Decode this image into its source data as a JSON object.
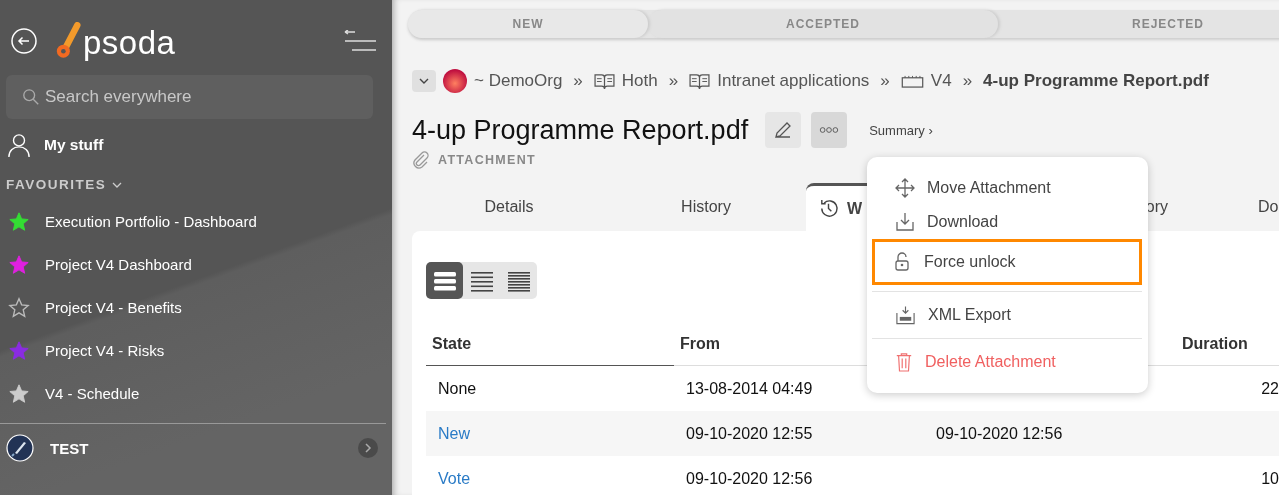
{
  "sidebar": {
    "logo": "psoda",
    "search": {
      "placeholder": "Search everywhere"
    },
    "my_stuff": "My stuff",
    "favourites_heading": "FAVOURITES",
    "favourites": [
      {
        "label": "Execution Portfolio - Dashboard",
        "kind": "filled",
        "color": "#33dd33"
      },
      {
        "label": "Project V4 Dashboard",
        "kind": "filled",
        "color": "#e020e0"
      },
      {
        "label": "Project V4 - Benefits",
        "kind": "outline",
        "color": "#bbbbbb"
      },
      {
        "label": "Project V4 - Risks",
        "kind": "filled",
        "color": "#8a2be2"
      },
      {
        "label": "V4 - Schedule",
        "kind": "filled",
        "color": "#cccccc"
      }
    ],
    "workspace": "TEST"
  },
  "steps": [
    {
      "label": "NEW"
    },
    {
      "label": "ACCEPTED"
    },
    {
      "label": "REJECTED"
    }
  ],
  "breadcrumb": [
    {
      "label": "~ DemoOrg",
      "kind": "org"
    },
    {
      "label": "Hoth",
      "kind": "book",
      "separator": "»"
    },
    {
      "label": "Intranet applications",
      "kind": "book",
      "separator": "»"
    },
    {
      "label": "V4",
      "kind": "folder",
      "separator": "»"
    },
    {
      "label": "4-up Programme Report.pdf",
      "kind": "current",
      "separator": "»"
    }
  ],
  "title": "4-up Programme Report.pdf",
  "summary_link": "Summary ›",
  "type_label": "ATTACHMENT",
  "tabs": [
    {
      "label": "Details",
      "selected": false
    },
    {
      "label": "History",
      "selected": false
    },
    {
      "label": "W",
      "selected": true
    },
    {
      "label": "ory",
      "selected": false
    },
    {
      "label": "Do",
      "selected": false
    }
  ],
  "view_modes": [
    {
      "selected": true
    },
    {
      "selected": false
    },
    {
      "selected": false
    }
  ],
  "table": {
    "columns": [
      "State",
      "From",
      "",
      "Duration"
    ],
    "rows": [
      {
        "kind": "plain",
        "cells": [
          "None",
          "13-08-2014 04:49",
          "",
          "22"
        ]
      },
      {
        "kind": "link",
        "cells": [
          "New",
          "09-10-2020 12:55",
          "09-10-2020 12:56",
          ""
        ]
      },
      {
        "kind": "link",
        "cells": [
          "Vote",
          "09-10-2020 12:56",
          "",
          "10"
        ]
      }
    ]
  },
  "menu": {
    "groups": [
      [
        {
          "label": "Move Attachment",
          "kind": "normal",
          "highlighted": false
        },
        {
          "label": "Download",
          "kind": "normal",
          "highlighted": false
        },
        {
          "label": "Force unlock",
          "kind": "normal",
          "highlighted": true
        }
      ],
      [
        {
          "label": "XML Export",
          "kind": "normal",
          "highlighted": false
        }
      ],
      [
        {
          "label": "Delete Attachment",
          "kind": "danger",
          "highlighted": false
        }
      ]
    ]
  }
}
